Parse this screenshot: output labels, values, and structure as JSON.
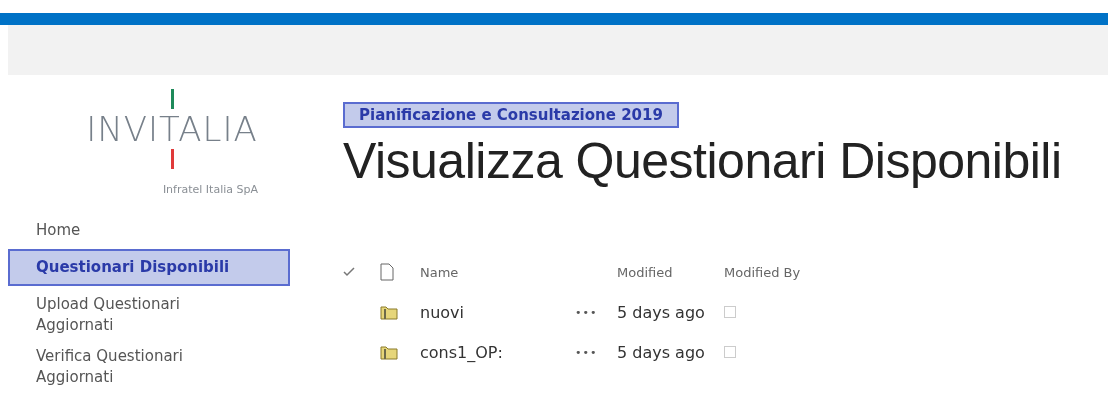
{
  "logo": {
    "wordmark": "INVITALIA",
    "tagline": "Infratel Italia SpA"
  },
  "nav": [
    {
      "label": "Home",
      "selected": false
    },
    {
      "label": "Questionari Disponibili",
      "selected": true
    },
    {
      "label": "Upload Questionari Aggiornati",
      "selected": false
    },
    {
      "label": "Verifica Questionari Aggiornati",
      "selected": false
    }
  ],
  "breadcrumb": "Pianificazione e Consultazione 2019",
  "page_title": "Visualizza Questionari Disponibili",
  "table": {
    "columns": [
      "Name",
      "Modified",
      "Modified By"
    ],
    "rows": [
      {
        "name": "nuovi",
        "actions": "•••",
        "modified": "5 days ago",
        "checked": false
      },
      {
        "name": "cons1_OP:",
        "actions": "•••",
        "modified": "5 days ago",
        "checked": false
      }
    ]
  }
}
